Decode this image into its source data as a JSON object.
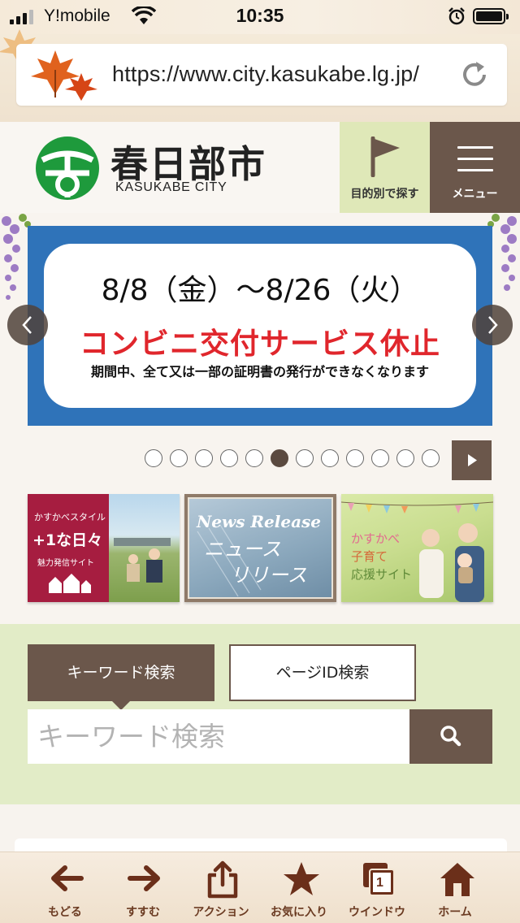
{
  "status": {
    "carrier": "Y!mobile",
    "time": "10:35"
  },
  "browser": {
    "url": "https://www.city.kasukabe.lg.jp/"
  },
  "header": {
    "name_jp": "春日部市",
    "name_en": "KASUKABE CITY",
    "purpose_label": "目的別で探す",
    "menu_label": "メニュー"
  },
  "slider": {
    "date": "8/8（金）～8/26（火）",
    "title": "コンビニ交付サービス休止",
    "subtitle": "期間中、全て又は一部の証明書の発行ができなくなります",
    "dot_count": 12,
    "active_dot": 6
  },
  "banners": {
    "style": {
      "line1": "かすかべスタイル",
      "line2": "+1な日々",
      "line3": "魅力発信サイト"
    },
    "news": {
      "line1": "News Release",
      "line2": "ニュース",
      "line3": "リリース"
    },
    "kosodate": {
      "line1": "かすかべ",
      "line2": "子育て",
      "line3": "応援サイト"
    }
  },
  "search": {
    "tab_keyword": "キーワード検索",
    "tab_pageid": "ページID検索",
    "placeholder": "キーワード検索"
  },
  "toolbar": {
    "back": "もどる",
    "forward": "すすむ",
    "action": "アクション",
    "favorites": "お気に入り",
    "window": "ウインドウ",
    "window_count": "1",
    "home": "ホーム"
  },
  "colors": {
    "brown": "#6b574b",
    "slide_blue": "#2f73b9",
    "slide_red": "#e0262c",
    "search_bg": "#e2ecc7",
    "purpose_bg": "#dfe8b8",
    "logo_green": "#1e9a3c"
  }
}
